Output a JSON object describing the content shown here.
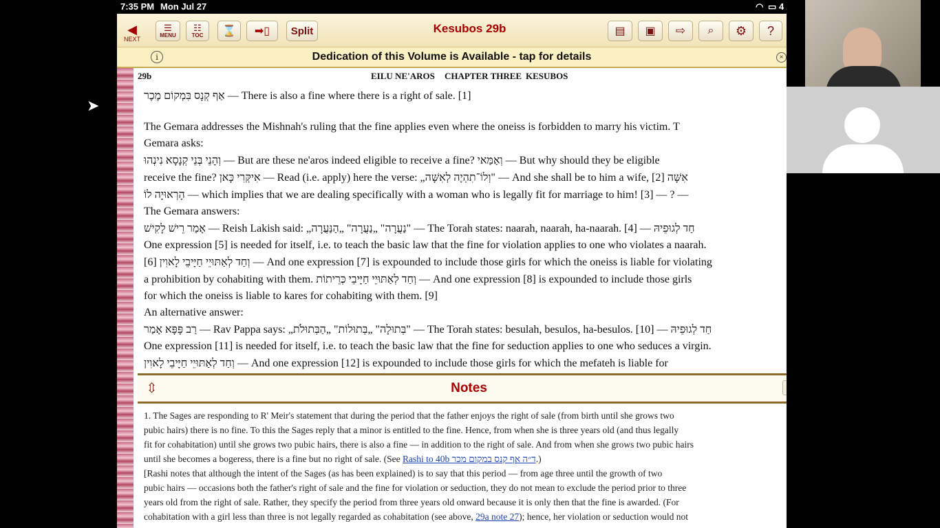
{
  "status_bar": {
    "time": "7:35 PM",
    "date": "Mon Jul 27",
    "battery": "4"
  },
  "toolbar": {
    "next_label": "NEXT",
    "menu_label": "MENU",
    "toc_label": "TOC",
    "split_label": "Split",
    "title": "Kesubos 29b",
    "icons": [
      "back-arrow-icon",
      "menu-icon",
      "toc-icon",
      "hourglass-icon",
      "bookmark-arrow-icon",
      "library-icon",
      "briefcase-icon",
      "forward-arrow-icon",
      "search-icon",
      "gear-icon",
      "help-icon"
    ],
    "help_label": "?"
  },
  "dedication": {
    "text": "Dedication of this Volume is Available - tap for details",
    "info_glyph": "i",
    "close_glyph": "×"
  },
  "page_header": {
    "folio": "29b",
    "section1": "EILU NE'AROS",
    "section2": "CHAPTER THREE",
    "section3": "KESUBOS"
  },
  "gemara_lines": [
    "אַף קְנָס בִּמְקוֹם מֶכֶר — There is also a fine where there is a right of sale. [1]",
    "",
    "    The Gemara addresses the Mishnah's ruling that the fine applies even where the oneiss is forbidden to marry his victim. T",
    "Gemara asks:",
    "וְהָנֵי בְּנֵי קְנָסָא נִינְהוּ — But are these ne'aros indeed eligible to receive a fine? וְאַמַּאי — But why should they be eligible",
    "receive the fine? אִיקְּרִי כָּאן — Read (i.e. apply) here the verse: „וְלוֹ־תִהְיֶה לְאִשָּׁה\" — And she shall be to him a wife, [2] אִשָּׁה",
    "הָרְאוּיָה לוֹ — which implies that we are dealing specifically with a woman who is legally fit for marriage to him! [3] — ? —",
    "    The Gemara answers:",
    "אָמַר רֵישׁ לָקִישׁ — Reish Lakish said: „נַעֲרָה\" „נַעֲרָה\" „הַנַּעֲרָה\" — The Torah states: naarah, naarah, ha-naarah. [4] — חַד לְגוּפֵיהּ",
    "One expression [5] is needed for itself, i.e. to teach the basic law that the fine for violation applies to one who violates a naarah.",
    "[6] וְחַד לְאַתּוּיֵי חַיָּיבֵי לָאוִין — And one expression [7] is expounded to include those girls for which the oneiss is liable for violating",
    "a prohibition by cohabiting with them. וְחַד לְאַתּוּיֵי חַיָּיבֵי כְּרֵיתוֹת — And one expression [8] is expounded to include those girls",
    "for which the oneiss is liable to kares for cohabiting with them. [9]",
    "    An alternative answer:",
    "רַב פָּפָּא אָמַר — Rav Pappa says: „בְּתוּלָה\" „בְּתוּלוֹת\" „הַבְּתוּלֹת\" — The Torah states: besulah, besulos, ha-besulos. [10] — חַד לְגוּפֵיהּ",
    "One expression [11] is needed for itself, i.e. to teach the basic law that the fine for seduction applies to one who seduces a virgin.",
    "וְחַד לְאַתּוּיֵי חַיָּיבֵי לָאוִין — And one expression [12] is expounded to include those girls for which the mefateh is liable for"
  ],
  "notes": {
    "title": "Notes",
    "help": "?",
    "lines": [
      "1. The Sages are responding to R' Meir's statement that during the period that the father enjoys the right of sale (from birth until she grows two",
      "pubic hairs) there is no fine. To this the Sages reply that a minor is entitled to the fine. Hence, from when she is three years old (and thus legally",
      "fit for cohabitation) until she grows two pubic hairs, there is also a fine — in addition to the right of sale. And from when she grows two pubic hairs",
      "until she becomes a bogeress, there is a fine but no right of sale. (See ",
      "[Rashi notes that although the intent of the Sages (as has been explained) is to say that this period — from age three until the growth of two",
      "pubic hairs — occasions both the father's right of sale and the fine for violation or seduction, they do not mean to exclude the period prior to three",
      "years old from the right of sale. Rather, they specify the period from three years old onward because it is only then that the fine is awarded. (For",
      "cohabitation with a girl less than three is not legally regarded as cohabitation (see above, "
    ],
    "link1": "Rashi to 40b ד״ה אף קנס במקום מכר",
    "link1_tail": ".)",
    "link2": "29a note 27",
    "link2_tail": "); hence, her violation or seduction would not"
  }
}
